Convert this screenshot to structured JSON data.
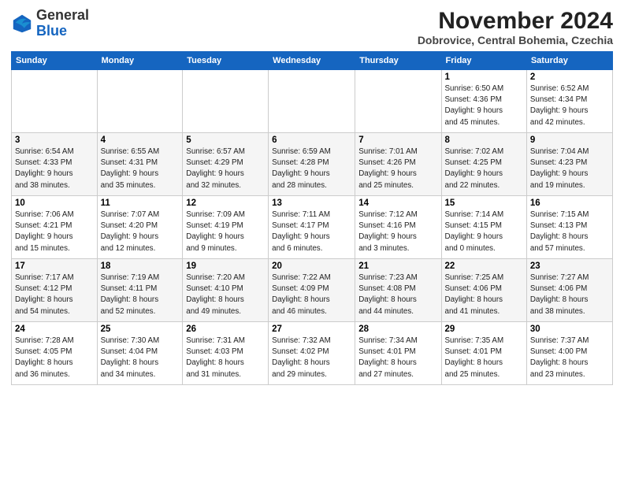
{
  "header": {
    "logo": {
      "general": "General",
      "blue": "Blue"
    },
    "month_title": "November 2024",
    "location": "Dobrovice, Central Bohemia, Czechia"
  },
  "weekdays": [
    "Sunday",
    "Monday",
    "Tuesday",
    "Wednesday",
    "Thursday",
    "Friday",
    "Saturday"
  ],
  "weeks": [
    [
      {
        "day": "",
        "info": ""
      },
      {
        "day": "",
        "info": ""
      },
      {
        "day": "",
        "info": ""
      },
      {
        "day": "",
        "info": ""
      },
      {
        "day": "",
        "info": ""
      },
      {
        "day": "1",
        "info": "Sunrise: 6:50 AM\nSunset: 4:36 PM\nDaylight: 9 hours\nand 45 minutes."
      },
      {
        "day": "2",
        "info": "Sunrise: 6:52 AM\nSunset: 4:34 PM\nDaylight: 9 hours\nand 42 minutes."
      }
    ],
    [
      {
        "day": "3",
        "info": "Sunrise: 6:54 AM\nSunset: 4:33 PM\nDaylight: 9 hours\nand 38 minutes."
      },
      {
        "day": "4",
        "info": "Sunrise: 6:55 AM\nSunset: 4:31 PM\nDaylight: 9 hours\nand 35 minutes."
      },
      {
        "day": "5",
        "info": "Sunrise: 6:57 AM\nSunset: 4:29 PM\nDaylight: 9 hours\nand 32 minutes."
      },
      {
        "day": "6",
        "info": "Sunrise: 6:59 AM\nSunset: 4:28 PM\nDaylight: 9 hours\nand 28 minutes."
      },
      {
        "day": "7",
        "info": "Sunrise: 7:01 AM\nSunset: 4:26 PM\nDaylight: 9 hours\nand 25 minutes."
      },
      {
        "day": "8",
        "info": "Sunrise: 7:02 AM\nSunset: 4:25 PM\nDaylight: 9 hours\nand 22 minutes."
      },
      {
        "day": "9",
        "info": "Sunrise: 7:04 AM\nSunset: 4:23 PM\nDaylight: 9 hours\nand 19 minutes."
      }
    ],
    [
      {
        "day": "10",
        "info": "Sunrise: 7:06 AM\nSunset: 4:21 PM\nDaylight: 9 hours\nand 15 minutes."
      },
      {
        "day": "11",
        "info": "Sunrise: 7:07 AM\nSunset: 4:20 PM\nDaylight: 9 hours\nand 12 minutes."
      },
      {
        "day": "12",
        "info": "Sunrise: 7:09 AM\nSunset: 4:19 PM\nDaylight: 9 hours\nand 9 minutes."
      },
      {
        "day": "13",
        "info": "Sunrise: 7:11 AM\nSunset: 4:17 PM\nDaylight: 9 hours\nand 6 minutes."
      },
      {
        "day": "14",
        "info": "Sunrise: 7:12 AM\nSunset: 4:16 PM\nDaylight: 9 hours\nand 3 minutes."
      },
      {
        "day": "15",
        "info": "Sunrise: 7:14 AM\nSunset: 4:15 PM\nDaylight: 9 hours\nand 0 minutes."
      },
      {
        "day": "16",
        "info": "Sunrise: 7:15 AM\nSunset: 4:13 PM\nDaylight: 8 hours\nand 57 minutes."
      }
    ],
    [
      {
        "day": "17",
        "info": "Sunrise: 7:17 AM\nSunset: 4:12 PM\nDaylight: 8 hours\nand 54 minutes."
      },
      {
        "day": "18",
        "info": "Sunrise: 7:19 AM\nSunset: 4:11 PM\nDaylight: 8 hours\nand 52 minutes."
      },
      {
        "day": "19",
        "info": "Sunrise: 7:20 AM\nSunset: 4:10 PM\nDaylight: 8 hours\nand 49 minutes."
      },
      {
        "day": "20",
        "info": "Sunrise: 7:22 AM\nSunset: 4:09 PM\nDaylight: 8 hours\nand 46 minutes."
      },
      {
        "day": "21",
        "info": "Sunrise: 7:23 AM\nSunset: 4:08 PM\nDaylight: 8 hours\nand 44 minutes."
      },
      {
        "day": "22",
        "info": "Sunrise: 7:25 AM\nSunset: 4:06 PM\nDaylight: 8 hours\nand 41 minutes."
      },
      {
        "day": "23",
        "info": "Sunrise: 7:27 AM\nSunset: 4:06 PM\nDaylight: 8 hours\nand 38 minutes."
      }
    ],
    [
      {
        "day": "24",
        "info": "Sunrise: 7:28 AM\nSunset: 4:05 PM\nDaylight: 8 hours\nand 36 minutes."
      },
      {
        "day": "25",
        "info": "Sunrise: 7:30 AM\nSunset: 4:04 PM\nDaylight: 8 hours\nand 34 minutes."
      },
      {
        "day": "26",
        "info": "Sunrise: 7:31 AM\nSunset: 4:03 PM\nDaylight: 8 hours\nand 31 minutes."
      },
      {
        "day": "27",
        "info": "Sunrise: 7:32 AM\nSunset: 4:02 PM\nDaylight: 8 hours\nand 29 minutes."
      },
      {
        "day": "28",
        "info": "Sunrise: 7:34 AM\nSunset: 4:01 PM\nDaylight: 8 hours\nand 27 minutes."
      },
      {
        "day": "29",
        "info": "Sunrise: 7:35 AM\nSunset: 4:01 PM\nDaylight: 8 hours\nand 25 minutes."
      },
      {
        "day": "30",
        "info": "Sunrise: 7:37 AM\nSunset: 4:00 PM\nDaylight: 8 hours\nand 23 minutes."
      }
    ]
  ]
}
